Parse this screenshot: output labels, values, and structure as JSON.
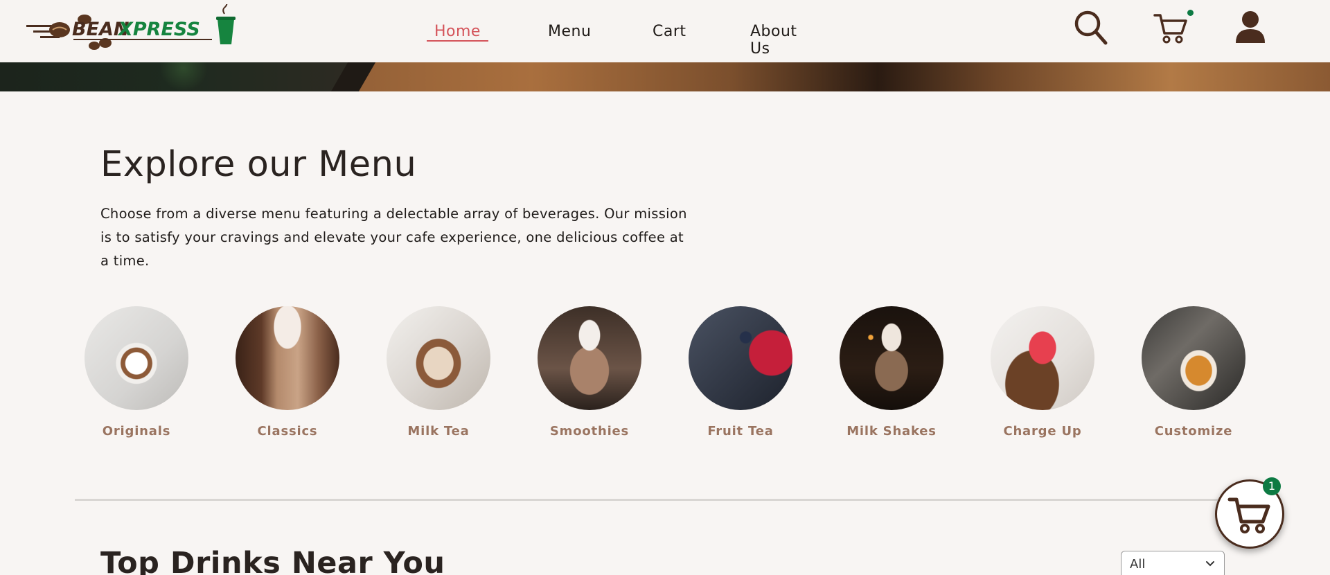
{
  "brand": {
    "name_part1": "BEAN",
    "name_part2": "XPRESS"
  },
  "nav": {
    "items": [
      {
        "label": "Home",
        "active": true
      },
      {
        "label": "Menu",
        "active": false
      },
      {
        "label": "Cart",
        "active": false
      },
      {
        "label": "About Us",
        "active": false
      }
    ]
  },
  "header_icons": [
    "search-icon",
    "cart-icon",
    "user-icon"
  ],
  "cart_dot_color": "#0d7a43",
  "explore": {
    "title": "Explore our Menu",
    "description": "Choose from a diverse menu featuring a delectable array of beverages. Our mission is to satisfy your cravings and elevate your cafe experience, one delicious coffee at a time."
  },
  "categories": [
    {
      "label": "Originals"
    },
    {
      "label": "Classics"
    },
    {
      "label": "Milk Tea"
    },
    {
      "label": "Smoothies"
    },
    {
      "label": "Fruit Tea"
    },
    {
      "label": "Milk Shakes"
    },
    {
      "label": "Charge Up"
    },
    {
      "label": "Customize"
    }
  ],
  "top_drinks": {
    "title": "Top Drinks Near You",
    "filter_value": "All"
  },
  "floating_cart": {
    "count": "1"
  },
  "colors": {
    "accent": "#d4535a",
    "brown": "#4a2c1e",
    "label": "#9a7460",
    "green": "#0d7a43"
  }
}
